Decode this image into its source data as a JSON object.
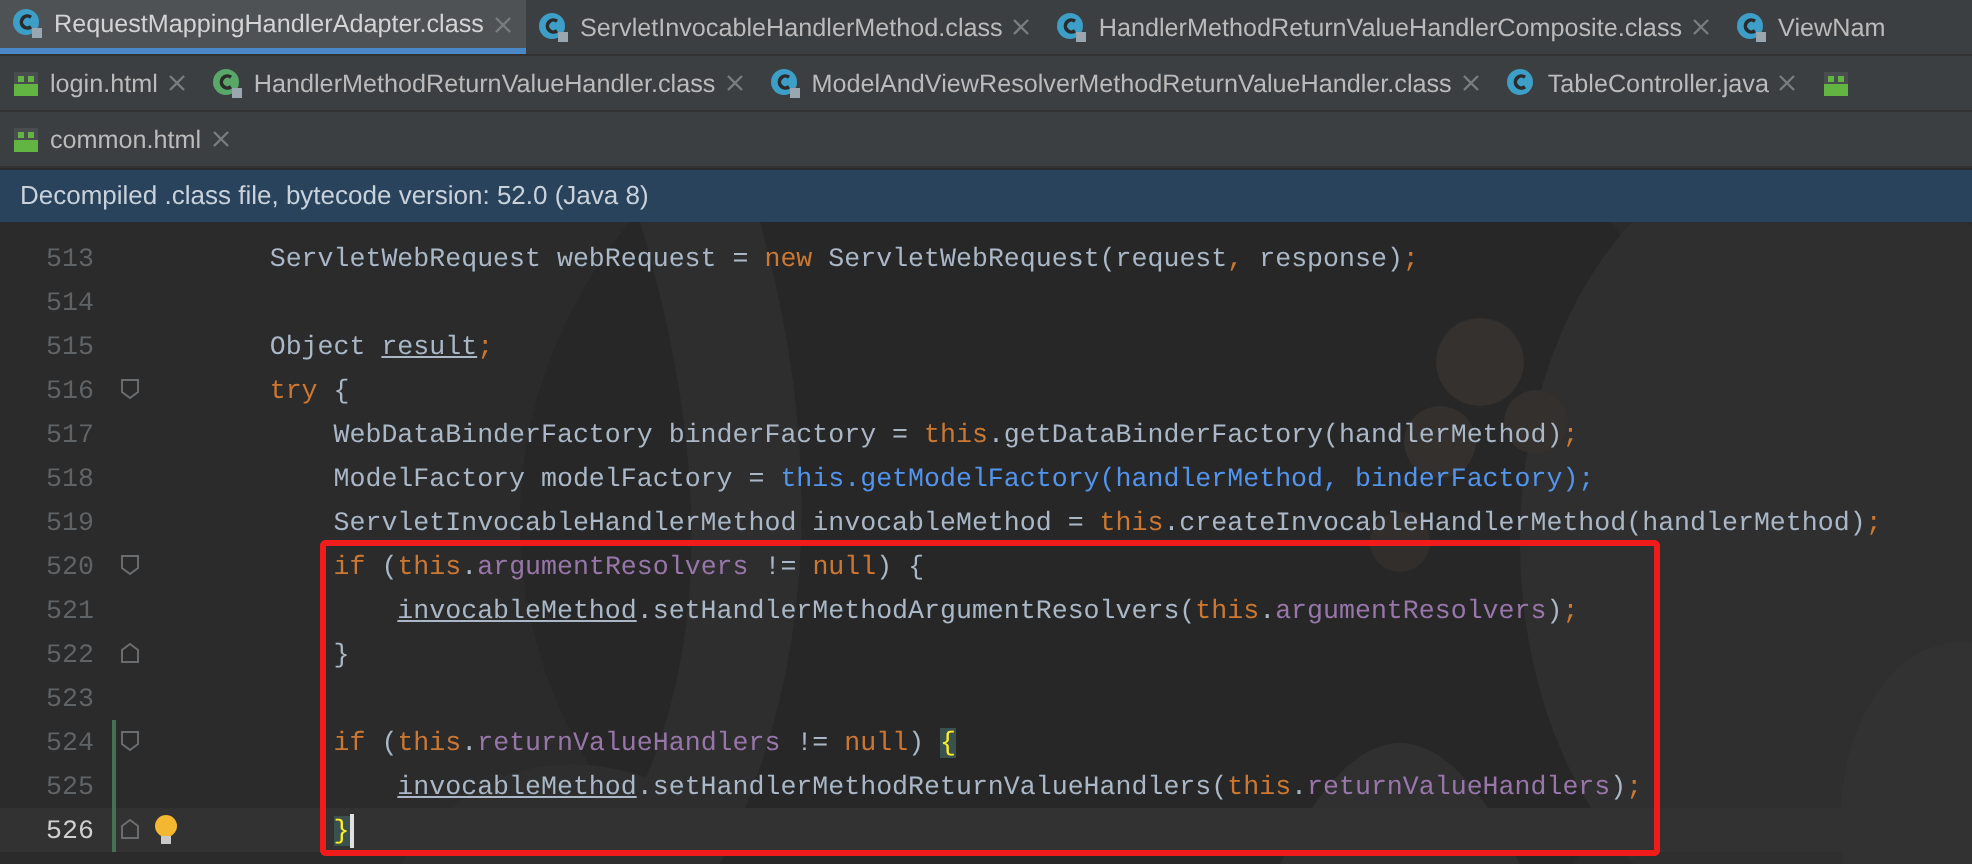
{
  "tab_rows": [
    {
      "tabs": [
        {
          "label": "RequestMappingHandlerAdapter.class",
          "kind": "class",
          "selected": true,
          "closable": true
        },
        {
          "label": "ServletInvocableHandlerMethod.class",
          "kind": "class",
          "selected": false,
          "closable": true
        },
        {
          "label": "HandlerMethodReturnValueHandlerComposite.class",
          "kind": "class",
          "selected": false,
          "closable": true
        },
        {
          "label": "ViewNam",
          "kind": "class",
          "selected": false,
          "closable": false
        }
      ]
    },
    {
      "tabs": [
        {
          "label": "login.html",
          "kind": "html",
          "selected": false,
          "closable": true
        },
        {
          "label": "HandlerMethodReturnValueHandler.class",
          "kind": "interface",
          "selected": false,
          "closable": true
        },
        {
          "label": "ModelAndViewResolverMethodReturnValueHandler.class",
          "kind": "class",
          "selected": false,
          "closable": true
        },
        {
          "label": "TableController.java",
          "kind": "java",
          "selected": false,
          "closable": true
        },
        {
          "kind": "html",
          "selected": false,
          "closable": false
        }
      ]
    },
    {
      "tabs": [
        {
          "label": "common.html",
          "kind": "html",
          "selected": false,
          "closable": true
        }
      ]
    }
  ],
  "banner": "Decompiled .class file, bytecode version: 52.0 (Java 8)",
  "editor": {
    "lines": [
      {
        "number": "513",
        "tokens": [
          {
            "t": "        ServletWebRequest webRequest = ",
            "kind": "plain"
          },
          {
            "t": "new",
            "kind": "keyword"
          },
          {
            "t": " ServletWebRequest(request",
            "kind": "plain"
          },
          {
            "t": ",",
            "kind": "keyword"
          },
          {
            "t": " response)",
            "kind": "plain"
          },
          {
            "t": ";",
            "kind": "keyword"
          }
        ]
      },
      {
        "number": "514"
      },
      {
        "number": "515",
        "tokens": [
          {
            "t": "        Object ",
            "kind": "plain"
          },
          {
            "t": "result",
            "kind": "underlined"
          },
          {
            "t": ";",
            "kind": "keyword"
          }
        ]
      },
      {
        "number": "516",
        "fold_start": true,
        "tokens": [
          {
            "t": "        try",
            "kind": "keyword"
          },
          {
            "t": " {",
            "kind": "plain"
          }
        ]
      },
      {
        "number": "517",
        "tokens": [
          {
            "t": "            WebDataBinderFactory binderFactory = ",
            "kind": "plain"
          },
          {
            "t": "this",
            "kind": "keyword"
          },
          {
            "t": ".getDataBinderFactory(handlerMethod)",
            "kind": "plain"
          },
          {
            "t": ";",
            "kind": "keyword"
          }
        ]
      },
      {
        "number": "518",
        "tokens": [
          {
            "t": "            ModelFactory modelFactory = ",
            "kind": "plain"
          },
          {
            "t": "this.getModelFactory(handlerMethod, binderFactory);",
            "kind": "highlight"
          }
        ]
      },
      {
        "number": "519",
        "tokens": [
          {
            "t": "            ServletInvocableHandlerMethod invocableMethod = ",
            "kind": "plain"
          },
          {
            "t": "this",
            "kind": "keyword"
          },
          {
            "t": ".createInvocableHandlerMethod(handlerMethod)",
            "kind": "plain"
          },
          {
            "t": ";",
            "kind": "keyword"
          }
        ]
      },
      {
        "number": "520",
        "fold_start": true,
        "boxed": true,
        "tokens": [
          {
            "t": "            if",
            "kind": "keyword"
          },
          {
            "t": " (",
            "kind": "plain"
          },
          {
            "t": "this",
            "kind": "keyword"
          },
          {
            "t": ".",
            "kind": "plain"
          },
          {
            "t": "argumentResolvers",
            "kind": "field"
          },
          {
            "t": " != ",
            "kind": "plain"
          },
          {
            "t": "null",
            "kind": "keyword"
          },
          {
            "t": ") {",
            "kind": "plain"
          }
        ]
      },
      {
        "number": "521",
        "boxed": true,
        "tokens": [
          {
            "t": "                invocableMethod",
            "kind": "underlined"
          },
          {
            "t": ".setHandlerMethodArgumentResolvers(",
            "kind": "plain"
          },
          {
            "t": "this",
            "kind": "keyword"
          },
          {
            "t": ".",
            "kind": "plain"
          },
          {
            "t": "argumentResolvers",
            "kind": "field"
          },
          {
            "t": ")",
            "kind": "plain"
          },
          {
            "t": ";",
            "kind": "keyword"
          }
        ]
      },
      {
        "number": "522",
        "fold_end": true,
        "boxed": true,
        "tokens": [
          {
            "t": "            }",
            "kind": "plain"
          }
        ]
      },
      {
        "number": "523",
        "boxed": true
      },
      {
        "number": "524",
        "fold_start": true,
        "boxed": true,
        "changed": true,
        "tokens": [
          {
            "t": "            if",
            "kind": "keyword"
          },
          {
            "t": " (",
            "kind": "plain"
          },
          {
            "t": "this",
            "kind": "keyword"
          },
          {
            "t": ".",
            "kind": "plain"
          },
          {
            "t": "returnValueHandlers",
            "kind": "field"
          },
          {
            "t": " != ",
            "kind": "plain"
          },
          {
            "t": "null",
            "kind": "keyword"
          },
          {
            "t": ") ",
            "kind": "plain"
          },
          {
            "t": "{",
            "kind": "brace"
          }
        ]
      },
      {
        "number": "525",
        "boxed": true,
        "changed": true,
        "tokens": [
          {
            "t": "                invocableMethod",
            "kind": "underlined"
          },
          {
            "t": ".setHandlerMethodReturnValueHandlers(",
            "kind": "plain"
          },
          {
            "t": "this",
            "kind": "keyword"
          },
          {
            "t": ".",
            "kind": "plain"
          },
          {
            "t": "returnValueHandlers",
            "kind": "field"
          },
          {
            "t": ")",
            "kind": "plain"
          },
          {
            "t": ";",
            "kind": "keyword"
          }
        ]
      },
      {
        "number": "526",
        "fold_end": true,
        "boxed": true,
        "changed": true,
        "current": true,
        "bulb": true,
        "caret": true,
        "tokens": [
          {
            "t": "            }",
            "kind": "brace"
          }
        ]
      }
    ]
  }
}
